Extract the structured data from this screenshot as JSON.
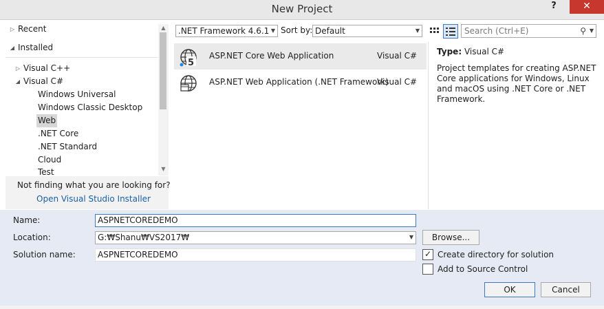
{
  "window": {
    "title": "New Project",
    "help_label": "?",
    "close_label": "✕"
  },
  "left": {
    "tree": [
      {
        "label": "Recent",
        "toggle": "▷"
      },
      {
        "label": "Installed",
        "toggle": "◢"
      },
      {
        "label": "Visual C++",
        "toggle": "▷"
      },
      {
        "label": "Visual C#",
        "toggle": "◢"
      },
      {
        "label": "Windows Universal"
      },
      {
        "label": "Windows Classic Desktop"
      },
      {
        "label": "Web"
      },
      {
        "label": ".NET Core"
      },
      {
        "label": ".NET Standard"
      },
      {
        "label": "Cloud"
      },
      {
        "label": "Test"
      }
    ],
    "not_finding": "Not finding what you are looking for?",
    "installer_link": "Open Visual Studio Installer"
  },
  "toolbar": {
    "framework": ".NET Framework 4.6.1",
    "sort_label": "Sort by:",
    "sort_value": "Default",
    "search_placeholder": "Search (Ctrl+E)"
  },
  "templates": [
    {
      "name": "ASP.NET Core Web Application",
      "lang": "Visual C#",
      "icon": "aspnet-core-globe-icon"
    },
    {
      "name": "ASP.NET Web Application (.NET Framework)",
      "lang": "Visual C#",
      "icon": "aspnet-globe-icon"
    }
  ],
  "details": {
    "type_label": "Type:",
    "type_value": "Visual C#",
    "description": "Project templates for creating ASP.NET Core applications for Windows, Linux and macOS using .NET Core or .NET Framework."
  },
  "form": {
    "name_label": "Name:",
    "name_value": "ASPNETCOREDEMO",
    "location_label": "Location:",
    "location_value": "G:₩Shanu₩VS2017₩",
    "solution_label": "Solution name:",
    "solution_value": "ASPNETCOREDEMO",
    "browse_label": "Browse...",
    "create_dir_label": "Create directory for solution",
    "create_dir_checked": true,
    "source_control_label": "Add to Source Control",
    "source_control_checked": false,
    "ok_label": "OK",
    "cancel_label": "Cancel"
  },
  "colors": {
    "accent": "#3b79c4",
    "link": "#1a5ea8",
    "close": "#c7372d",
    "bottom_panel": "#e6eaf4"
  }
}
